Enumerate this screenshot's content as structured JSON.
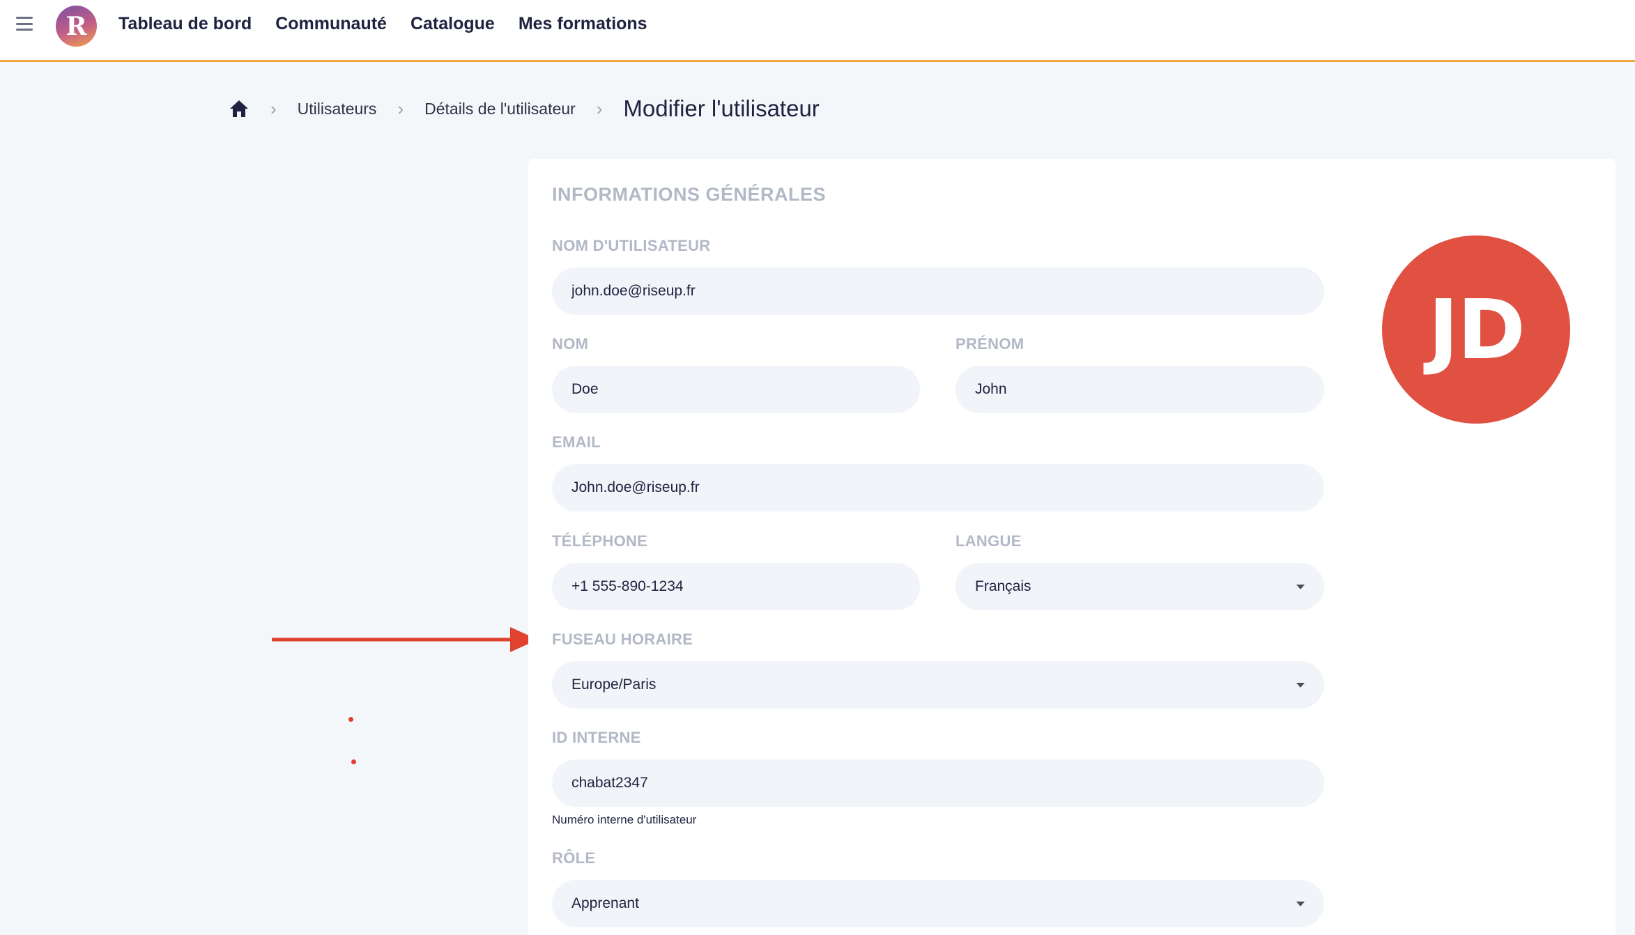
{
  "nav": {
    "menu_icon": "hamburger-menu-icon",
    "logo_letter": "R",
    "items": [
      "Tableau de bord",
      "Communauté",
      "Catalogue",
      "Mes formations"
    ]
  },
  "breadcrumb": {
    "home_icon": "home-icon",
    "items": [
      "Utilisateurs",
      "Détails de l'utilisateur"
    ],
    "current": "Modifier l'utilisateur"
  },
  "form": {
    "section_title": "INFORMATIONS GÉNÉRALES",
    "username": {
      "label": "NOM D'UTILISATEUR",
      "value": "john.doe@riseup.fr"
    },
    "lastname": {
      "label": "NOM",
      "value": "Doe"
    },
    "firstname": {
      "label": "PRÉNOM",
      "value": "John"
    },
    "email": {
      "label": "EMAIL",
      "value": "John.doe@riseup.fr"
    },
    "phone": {
      "label": "TÉLÉPHONE",
      "value": "+1 555-890-1234"
    },
    "language": {
      "label": "LANGUE",
      "value": "Français"
    },
    "timezone": {
      "label": "FUSEAU HORAIRE",
      "value": "Europe/Paris"
    },
    "internal_id": {
      "label": "ID INTERNE",
      "value": "chabat2347",
      "helper": "Numéro interne d'utilisateur"
    },
    "role": {
      "label": "RÔLE",
      "value": "Apprenant"
    }
  },
  "avatar": {
    "initials": "JD",
    "color": "#e05142"
  },
  "colors": {
    "accent": "#f0a640",
    "annotation": "#e0422e"
  }
}
